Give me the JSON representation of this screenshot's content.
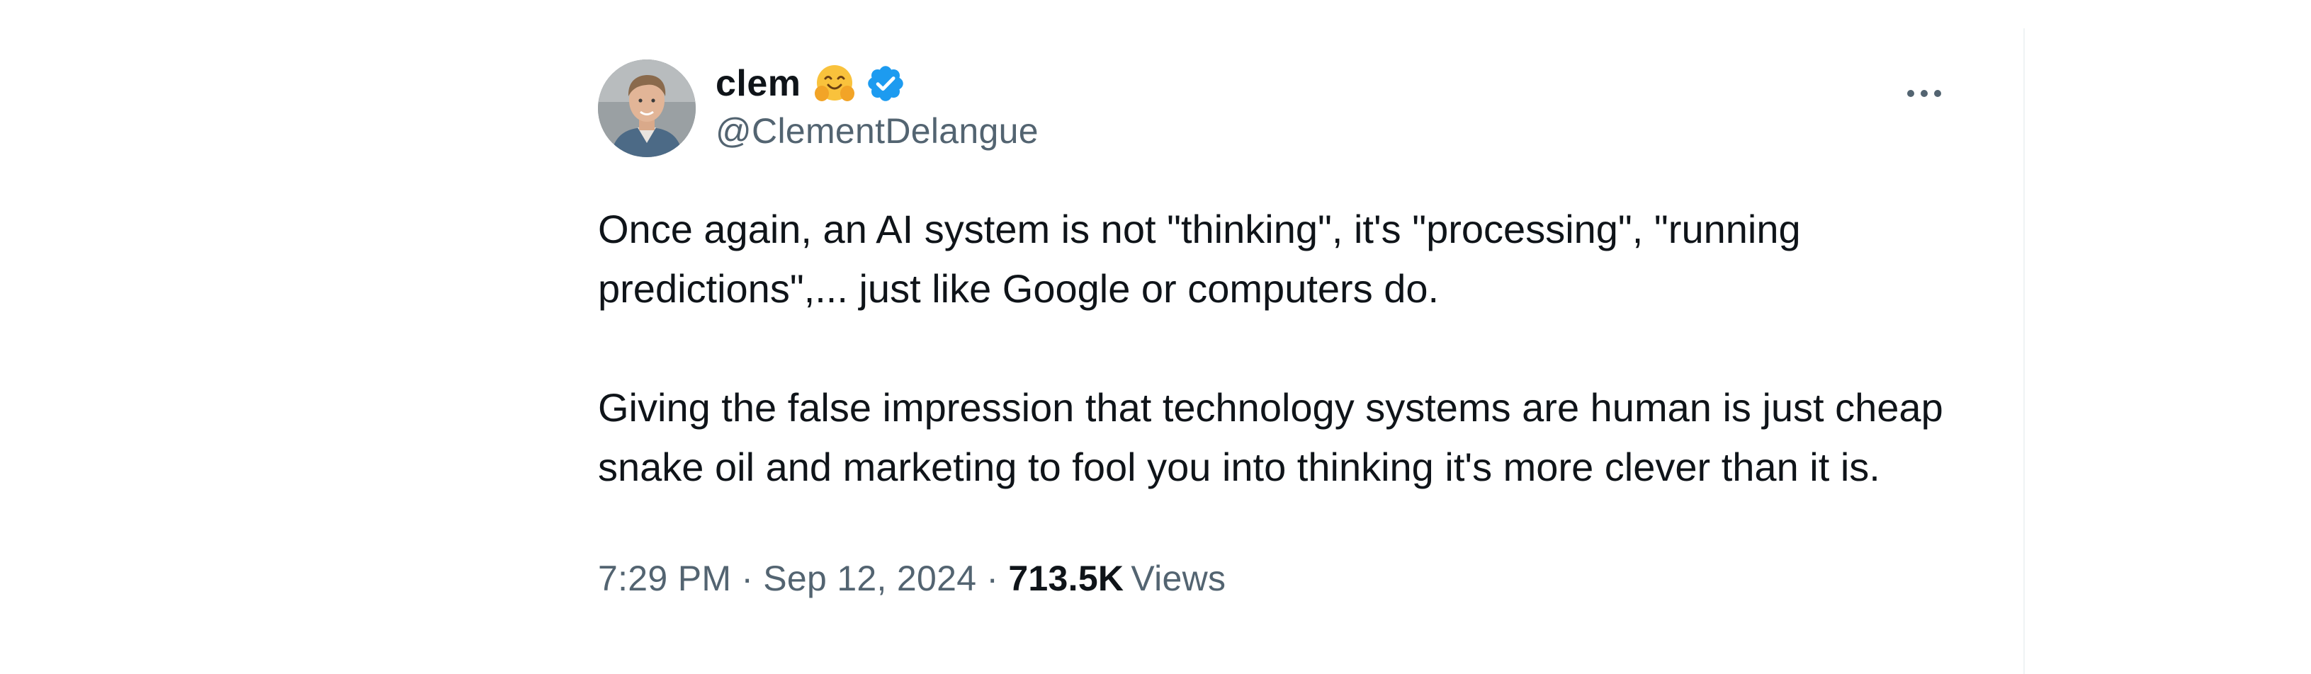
{
  "author": {
    "display_name": "clem",
    "emoji_icon": "hugging-face-emoji-icon",
    "verified_icon": "verified-badge-icon",
    "handle": "@ClementDelangue"
  },
  "tweet": {
    "paragraphs": [
      "Once again, an AI system is not \"thinking\", it's \"processing\", \"running predictions\",... just like Google or computers do.",
      "Giving the false impression that technology systems are human is just cheap snake oil and marketing to fool you into thinking it's more clever than it is."
    ],
    "time": "7:29 PM",
    "separator": "·",
    "date": "Sep 12, 2024",
    "views_count": "713.5K",
    "views_label": "Views"
  },
  "colors": {
    "text_primary": "#0f1419",
    "text_secondary": "#536471",
    "verified_blue": "#1d9bf0"
  }
}
